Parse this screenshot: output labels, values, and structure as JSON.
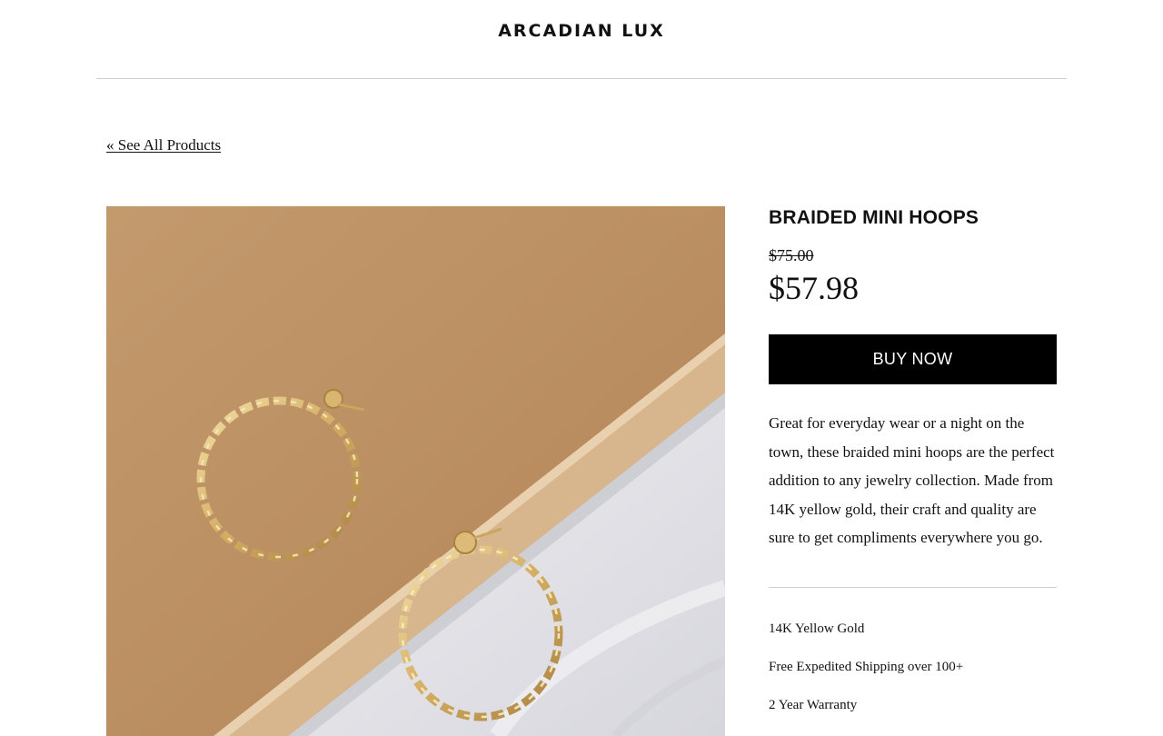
{
  "header": {
    "brand": "ARCADIAN LUX"
  },
  "nav": {
    "back_link": "« See All Products"
  },
  "product": {
    "title": "BRAIDED MINI HOOPS",
    "original_price": "$75.00",
    "sale_price": "$57.98",
    "buy_label": "BUY NOW",
    "description": "Great for everyday wear or a night on the town, these braided mini hoops are the perfect addition to any jewelry collection. Made from 14K yellow gold, their craft and quality are sure to get compliments everywhere you go.",
    "features": [
      "14K Yellow Gold",
      "Free Expedited Shipping over 100+",
      "2 Year Warranty"
    ]
  },
  "colors": {
    "button_bg": "#000000",
    "button_text": "#ffffff",
    "gold": "#d7b56d",
    "cardboard": "#bf9466",
    "fabric": "#e6e6ea"
  }
}
